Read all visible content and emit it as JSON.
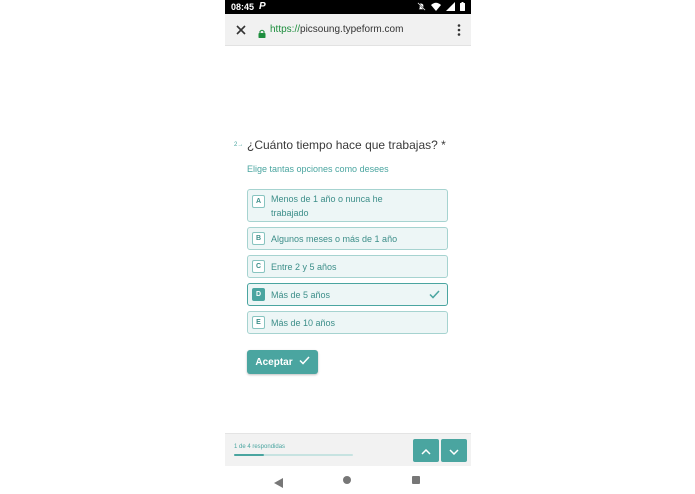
{
  "status_bar": {
    "time": "08:45",
    "app_badge": "P",
    "icons": [
      "mute-icon",
      "wifi-icon",
      "signal-icon",
      "battery-icon"
    ]
  },
  "browser": {
    "url_scheme": "https://",
    "url_host": "picsoung.typeform.com",
    "icons": [
      "close-icon",
      "lock-icon",
      "overflow-menu-icon"
    ]
  },
  "question": {
    "number": "2→",
    "title": "¿Cuánto tiempo hace que trabajas? *",
    "hint": "Elige tantas opciones como desees"
  },
  "choices": [
    {
      "key": "A",
      "label": "Menos de 1 año o nunca he trabajado",
      "selected": false
    },
    {
      "key": "B",
      "label": "Algunos meses o más de 1 año",
      "selected": false
    },
    {
      "key": "C",
      "label": "Entre 2 y 5 años",
      "selected": false
    },
    {
      "key": "D",
      "label": "Más de 5 años",
      "selected": true
    },
    {
      "key": "E",
      "label": "Más de 10 años",
      "selected": false
    }
  ],
  "accept_button": {
    "label": "Aceptar"
  },
  "footer": {
    "progress_text": "1 de 4 respondidas",
    "progress_fraction": 0.25
  },
  "colors": {
    "accent": "#4aa5a0",
    "choice_bg": "#edf6f6",
    "choice_border": "#a6d3d0",
    "url_green": "#1e8e3e"
  }
}
